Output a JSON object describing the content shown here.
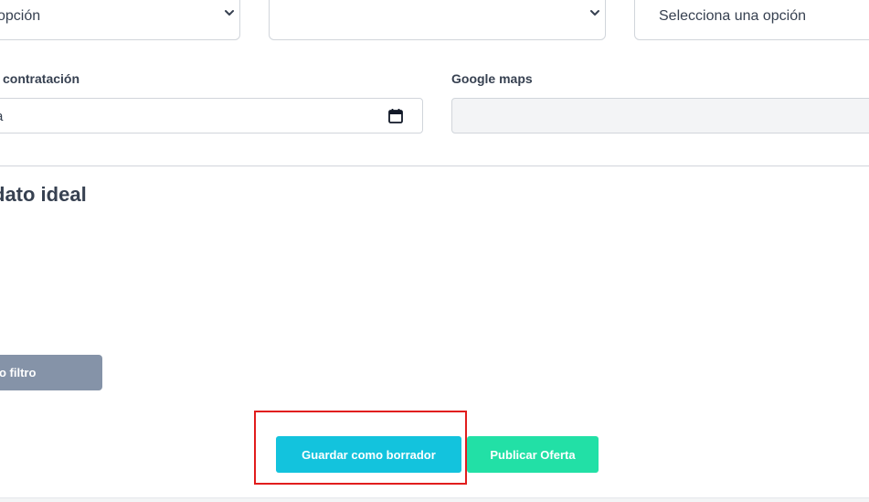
{
  "selects": [
    {
      "value": "opción"
    },
    {
      "value": ""
    },
    {
      "value": "Selecciona una opción"
    }
  ],
  "fields": {
    "hire_date_label": "contratación",
    "hire_date_value": "a",
    "google_maps_label": "Google maps",
    "google_maps_value": ""
  },
  "section": {
    "title": "dato ideal"
  },
  "buttons": {
    "filter_label": "o filtro",
    "save_draft_label": "Guardar como borrador",
    "publish_label": "Publicar Oferta"
  },
  "colors": {
    "draft_button": "#13c3dd",
    "publish_button": "#22e0a6",
    "filter_button": "#8593a8",
    "highlight": "#e11d1d"
  },
  "icons": [
    "chevron-down-icon",
    "calendar-icon"
  ]
}
